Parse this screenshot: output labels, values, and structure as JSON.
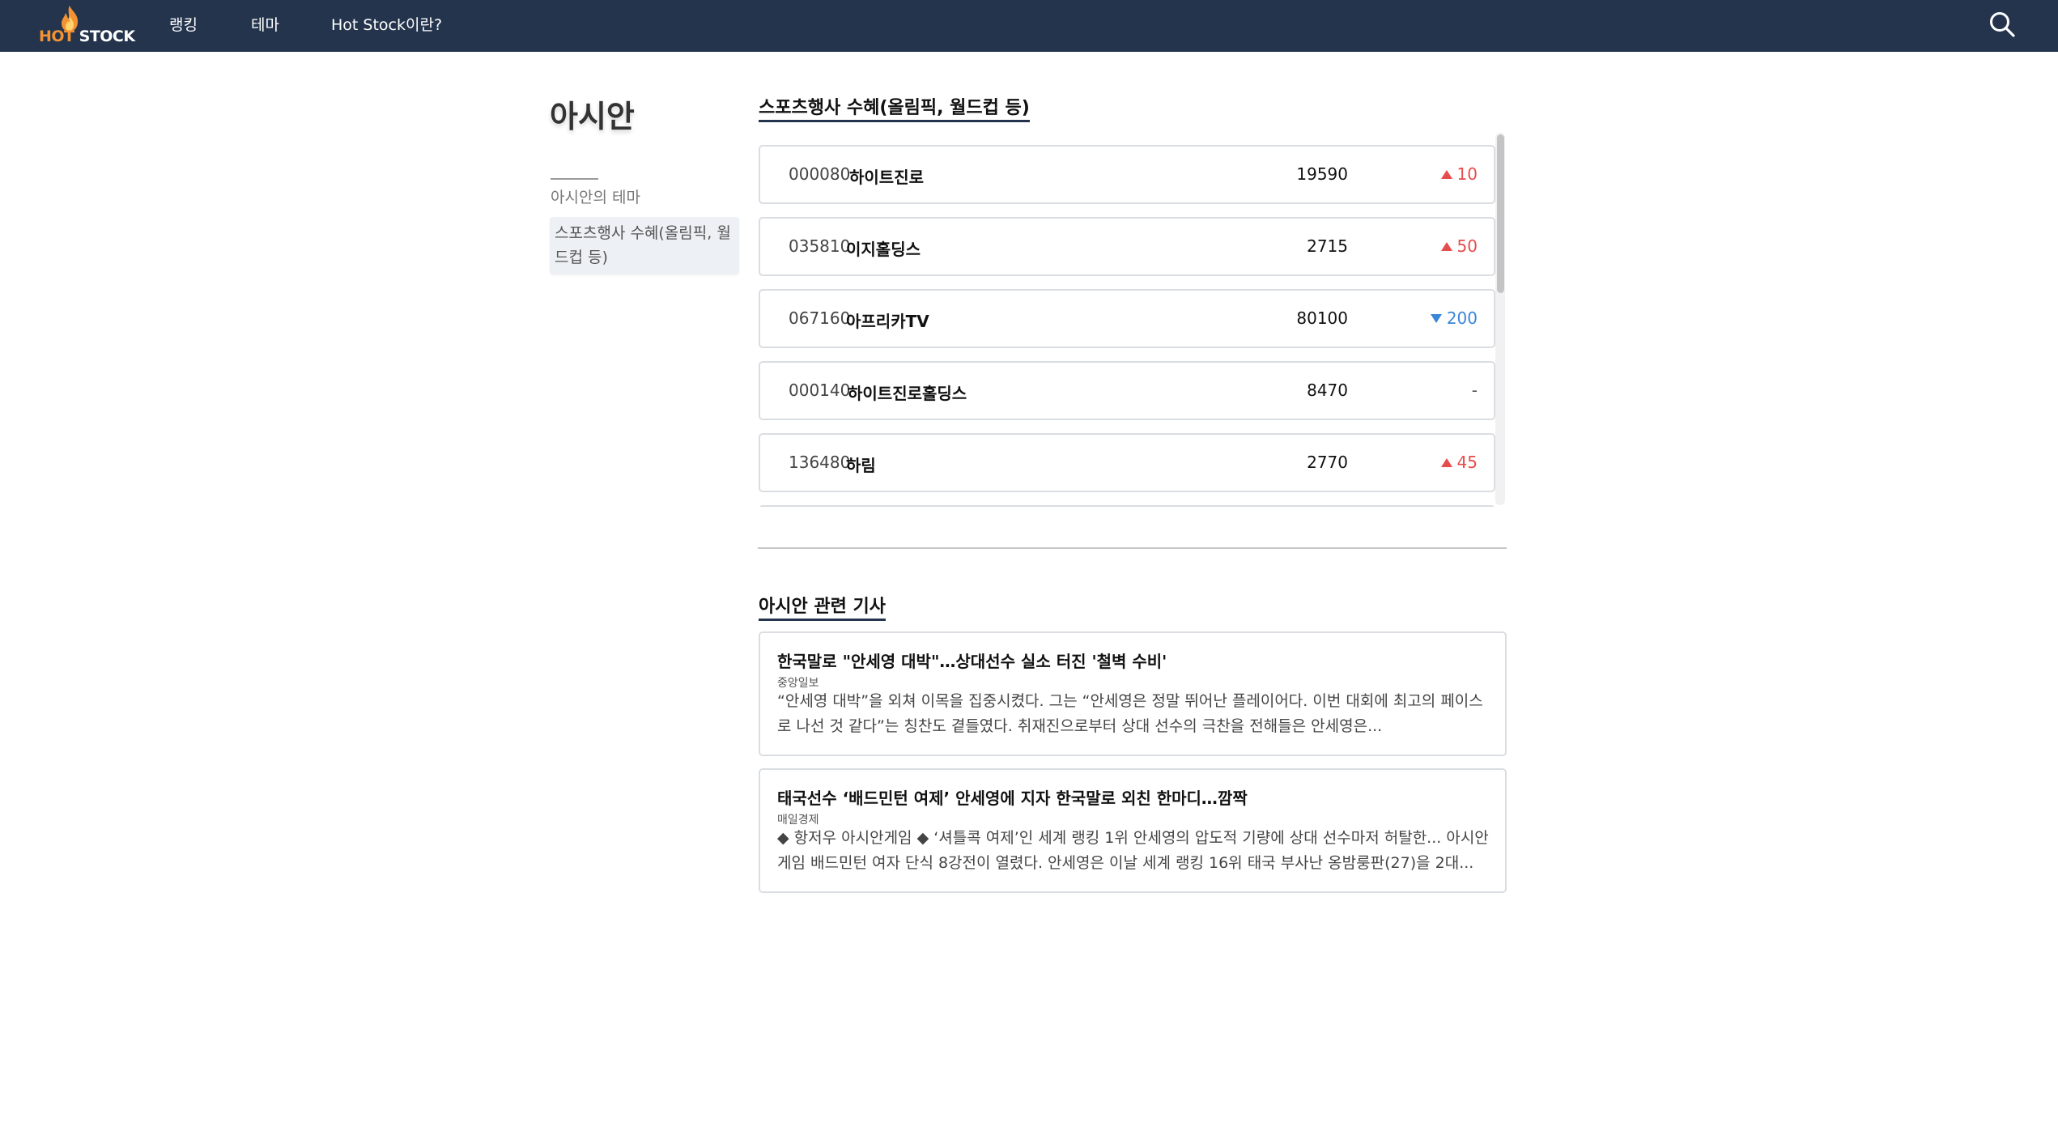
{
  "brand": {
    "logo_hot": "HOT",
    "logo_stock": "STOCK",
    "icon": "flame-icon",
    "hot_color": "#f39233"
  },
  "nav": {
    "items": [
      {
        "label": "랭킹"
      },
      {
        "label": "테마"
      },
      {
        "label": "Hot Stock이란?"
      }
    ],
    "search_icon": "search-icon",
    "bg_color": "#24344d"
  },
  "sidebar": {
    "title": "아시안",
    "heading": "아시안의 테마",
    "themes": [
      {
        "label": "스포츠행사 수혜(올림픽, 월드컵 등)"
      }
    ]
  },
  "stocks": {
    "section_title": "스포츠행사 수혜(올림픽, 월드컵 등)",
    "rows": [
      {
        "code": "000080",
        "name": "하이트진로",
        "price": "19590",
        "change": "10",
        "direction": "up"
      },
      {
        "code": "035810",
        "name": "이지홀딩스",
        "price": "2715",
        "change": "50",
        "direction": "up"
      },
      {
        "code": "067160",
        "name": "아프리카TV",
        "price": "80100",
        "change": "200",
        "direction": "down"
      },
      {
        "code": "000140",
        "name": "하이트진로홀딩스",
        "price": "8470",
        "change": "-",
        "direction": "flat"
      },
      {
        "code": "136480",
        "name": "하림",
        "price": "2770",
        "change": "45",
        "direction": "up"
      }
    ],
    "up_color": "#e74c4c",
    "down_color": "#3a86d8"
  },
  "news": {
    "section_title": "아시안 관련 기사",
    "articles": [
      {
        "title": "한국말로 \"안세영 대박\"…상대선수 실소 터진 '철벽 수비'",
        "source": "중앙일보",
        "summary": "“안세영 대박”을 외쳐 이목을 집중시켰다. 그는 “안세영은 정말 뛰어난 플레이어다. 이번 대회에 최고의 페이스로 나선 것 같다”는 칭찬도 곁들였다. 취재진으로부터 상대 선수의 극찬을 전해들은 안세영은..."
      },
      {
        "title": "태국선수 ‘배드민턴 여제’ 안세영에 지자 한국말로 외친 한마디…깜짝",
        "source": "매일경제",
        "summary": "◆ 항저우 아시안게임 ◆ ‘셔틀콕 여제’인 세계 랭킹 1위 안세영의 압도적 기량에 상대 선수마저 허탈한... 아시안게임 배드민턴 여자 단식 8강전이 열렸다. 안세영은 이날 세계 랭킹 16위 태국 부사난 옹밤룽판(27)을 2대..."
      }
    ]
  }
}
